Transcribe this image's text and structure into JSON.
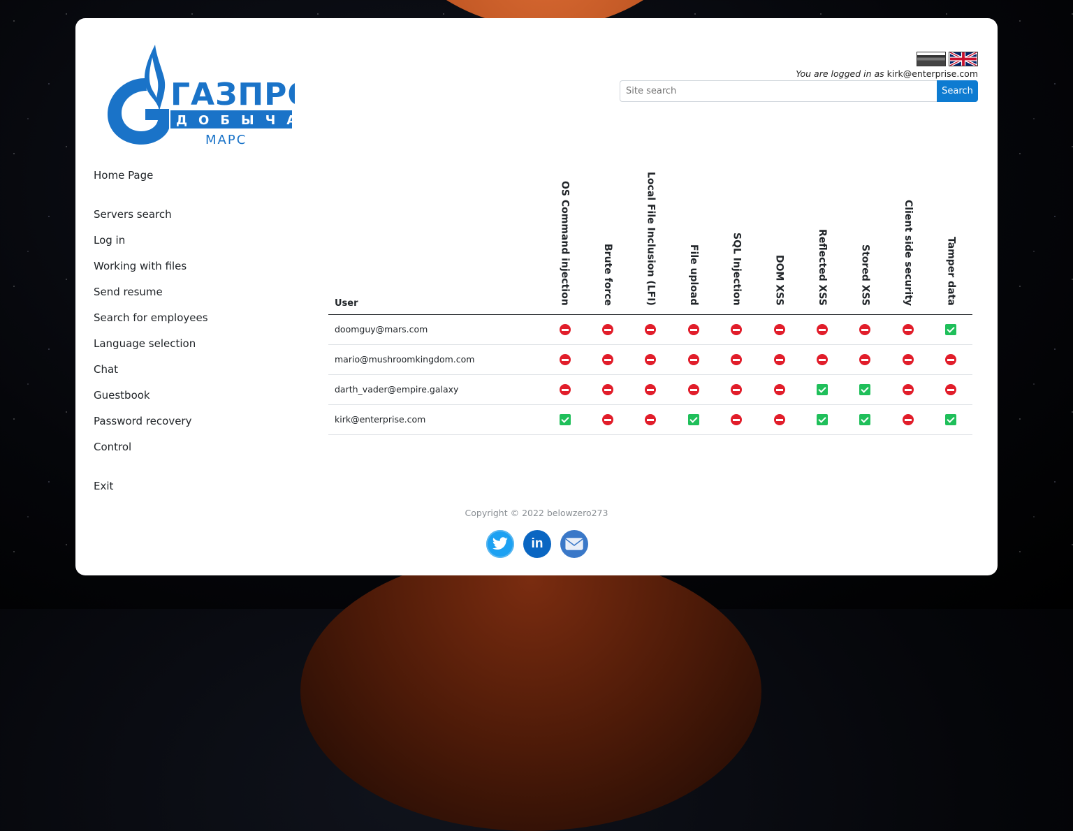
{
  "header": {
    "logo_text_main": "ГАЗПРОМ",
    "logo_text_sub": "ДОБЫЧА",
    "logo_text_place": "МАРС",
    "logged_prefix": "You are logged in as",
    "logged_user": "kirk@enterprise.com",
    "search_placeholder": "Site search",
    "search_button": "Search",
    "languages": [
      "ru-flag-icon",
      "uk-flag-icon"
    ]
  },
  "nav": {
    "home": "Home Page",
    "items": [
      "Servers search",
      "Log in",
      "Working with files",
      "Send resume",
      "Search for employees",
      "Language selection",
      "Chat",
      "Guestbook",
      "Password recovery",
      "Control"
    ],
    "exit": "Exit"
  },
  "table": {
    "user_header": "User",
    "columns": [
      "OS Command injection",
      "Brute force",
      "Local File Inclusion (LFI)",
      "File upload",
      "SQL Injection",
      "DOM XSS",
      "Reflected XSS",
      "Stored XSS",
      "Client side security",
      "Tamper data"
    ],
    "rows": [
      {
        "email": "doomguy@mars.com",
        "perms": [
          false,
          false,
          false,
          false,
          false,
          false,
          false,
          false,
          false,
          true
        ]
      },
      {
        "email": "mario@mushroomkingdom.com",
        "perms": [
          false,
          false,
          false,
          false,
          false,
          false,
          false,
          false,
          false,
          false
        ]
      },
      {
        "email": "darth_vader@empire.galaxy",
        "perms": [
          false,
          false,
          false,
          false,
          false,
          false,
          true,
          true,
          false,
          false
        ]
      },
      {
        "email": "kirk@enterprise.com",
        "perms": [
          true,
          false,
          false,
          true,
          false,
          false,
          true,
          true,
          false,
          true
        ]
      }
    ]
  },
  "footer": {
    "copyright": "Copyright © 2022 belowzero273",
    "social": [
      "twitter-icon",
      "linkedin-icon",
      "email-icon"
    ]
  },
  "colors": {
    "accent": "#0d7bd1",
    "logo_blue": "#1a73c8",
    "deny": "#e11d2a",
    "allow": "#1fbf5a"
  }
}
